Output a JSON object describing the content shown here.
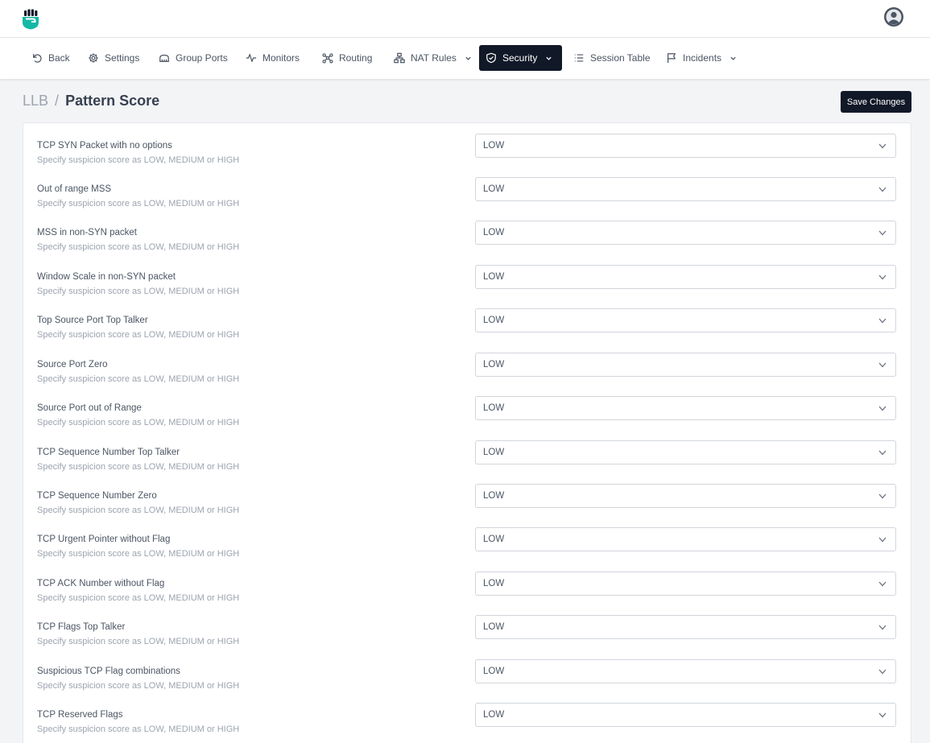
{
  "nav": {
    "items": [
      {
        "label": "Back",
        "icon": "undo-icon",
        "active": false,
        "dropdown": false
      },
      {
        "label": "Settings",
        "icon": "gear-icon",
        "active": false,
        "dropdown": false
      },
      {
        "label": "Group Ports",
        "icon": "ports-icon",
        "active": false,
        "dropdown": false
      },
      {
        "label": "Monitors",
        "icon": "pulse-icon",
        "active": false,
        "dropdown": false
      },
      {
        "label": "Routing",
        "icon": "nodes-icon",
        "active": false,
        "dropdown": false
      },
      {
        "label": "NAT Rules",
        "icon": "network-icon",
        "active": false,
        "dropdown": true
      },
      {
        "label": "Security",
        "icon": "shield-check-icon",
        "active": true,
        "dropdown": true
      },
      {
        "label": "Session Table",
        "icon": "list-icon",
        "active": false,
        "dropdown": false
      },
      {
        "label": "Incidents",
        "icon": "flag-icon",
        "active": false,
        "dropdown": true
      }
    ]
  },
  "breadcrumb": {
    "parent": "LLB",
    "separator": "/",
    "current": "Pattern Score"
  },
  "actions": {
    "save_label": "Save Changes"
  },
  "form": {
    "hint": "Specify suspicion score as LOW, MEDIUM or HIGH",
    "rows": [
      {
        "label": "TCP SYN Packet with no options",
        "value": "LOW"
      },
      {
        "label": "Out of range MSS",
        "value": "LOW"
      },
      {
        "label": "MSS in non-SYN packet",
        "value": "LOW"
      },
      {
        "label": "Window Scale in non-SYN packet",
        "value": "LOW"
      },
      {
        "label": "Top Source Port Top Talker",
        "value": "LOW"
      },
      {
        "label": "Source Port Zero",
        "value": "LOW"
      },
      {
        "label": "Source Port out of Range",
        "value": "LOW"
      },
      {
        "label": "TCP Sequence Number Top Talker",
        "value": "LOW"
      },
      {
        "label": "TCP Sequence Number Zero",
        "value": "LOW"
      },
      {
        "label": "TCP Urgent Pointer without Flag",
        "value": "LOW"
      },
      {
        "label": "TCP ACK Number without Flag",
        "value": "LOW"
      },
      {
        "label": "TCP Flags Top Talker",
        "value": "LOW"
      },
      {
        "label": "Suspicious TCP Flag combinations",
        "value": "LOW"
      },
      {
        "label": "TCP Reserved Flags",
        "value": "LOW"
      }
    ]
  },
  "colors": {
    "brand": "#14b8a6",
    "dark": "#111827",
    "text": "#4b5563",
    "muted": "#9ca3af"
  }
}
